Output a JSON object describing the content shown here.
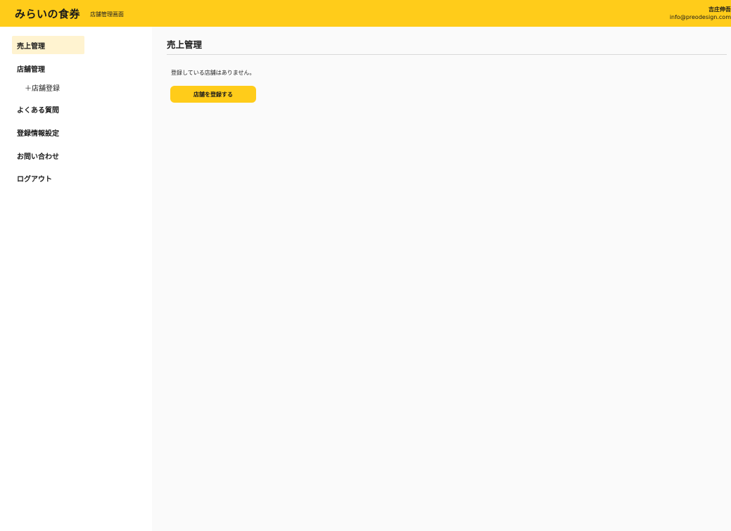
{
  "header": {
    "logo": "みらいの食券",
    "subtitle": "店舗管理画面",
    "user_name": "吉庄伸吾",
    "user_email": "info@preodesign.com"
  },
  "sidebar": {
    "items": [
      {
        "label": "売上管理",
        "active": true
      },
      {
        "label": "店舗管理",
        "active": false
      },
      {
        "label": "＋店舗登録",
        "active": false,
        "sub": true
      },
      {
        "label": "よくある質問",
        "active": false
      },
      {
        "label": "登録情報設定",
        "active": false
      },
      {
        "label": "お問い合わせ",
        "active": false
      },
      {
        "label": "ログアウト",
        "active": false
      }
    ]
  },
  "main": {
    "title": "売上管理",
    "empty_message": "登録している店舗はありません。",
    "register_button": "店舗を登録する"
  },
  "colors": {
    "accent": "#ffcc1a",
    "active_nav_bg": "#fff3d0",
    "main_bg": "#fafafa"
  }
}
